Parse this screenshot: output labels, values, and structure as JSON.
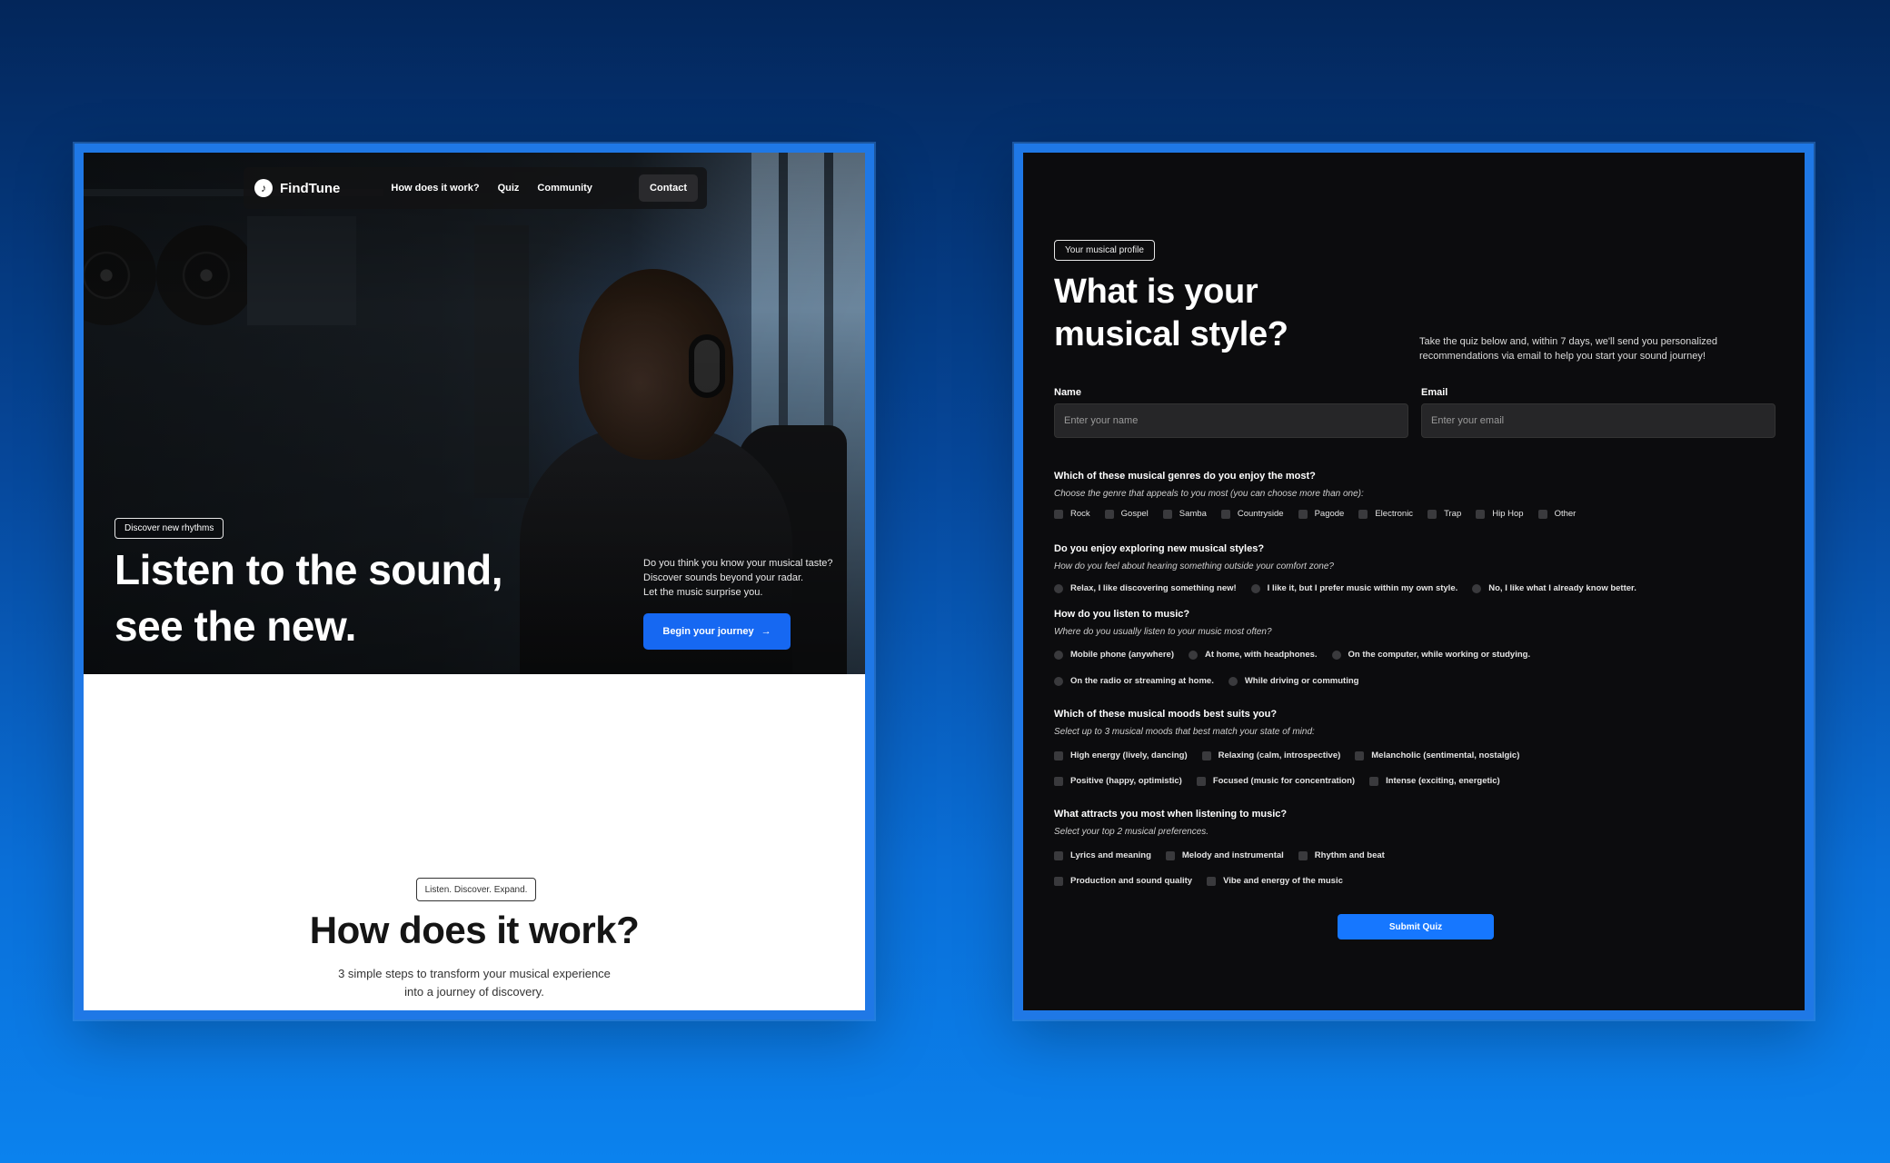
{
  "landing": {
    "nav": {
      "brand": "FindTune",
      "links": [
        "How does it work?",
        "Quiz",
        "Community"
      ],
      "contact": "Contact"
    },
    "hero": {
      "badge": "Discover new rhythms",
      "title_line1": "Listen to the sound,",
      "title_line2": "see the new.",
      "desc_line1": "Do you think you know your musical taste?",
      "desc_line2": "Discover sounds beyond your radar.",
      "desc_line3": "Let the music surprise you.",
      "cta": "Begin your journey",
      "cta_icon": "→"
    },
    "how": {
      "badge": "Listen. Discover. Expand.",
      "title": "How does it work?",
      "sub_line1": "3 simple steps to transform your musical experience",
      "sub_line2": "into a journey of discovery."
    }
  },
  "quiz": {
    "badge": "Your musical profile",
    "title": "What is your musical style?",
    "intro": "Take the quiz below and, within 7 days, we'll send you personalized recommendations via email to help you start your sound journey!",
    "name_label": "Name",
    "name_placeholder": "Enter your name",
    "email_label": "Email",
    "email_placeholder": "Enter your email",
    "q1": {
      "title": "Which of these musical genres do you enjoy the most?",
      "hint": "Choose the genre that appeals to you most (you can choose more than one):",
      "options": [
        "Rock",
        "Gospel",
        "Samba",
        "Countryside",
        "Pagode",
        "Electronic",
        "Trap",
        "Hip Hop",
        "Other"
      ]
    },
    "q2": {
      "title": "Do you enjoy exploring new musical styles?",
      "hint": "How do you feel about hearing something outside your comfort zone?",
      "options": [
        "Relax, I like discovering something new!",
        "I like it, but I prefer music within my own style.",
        "No, I like what I already know better."
      ]
    },
    "q3": {
      "title": "How do you listen to music?",
      "hint": "Where do you usually listen to your music most often?",
      "options": [
        "Mobile phone (anywhere)",
        "At home, with headphones.",
        "On the computer, while working or studying.",
        "On the radio or streaming at home.",
        "While driving or commuting"
      ]
    },
    "q4": {
      "title": "Which of these musical moods best suits you?",
      "hint": "Select up to 3 musical moods that best match your state of mind:",
      "options": [
        "High energy (lively, dancing)",
        "Relaxing (calm, introspective)",
        "Melancholic (sentimental, nostalgic)",
        "Positive (happy, optimistic)",
        "Focused (music for concentration)",
        "Intense (exciting, energetic)"
      ]
    },
    "q5": {
      "title": "What attracts you most when listening to music?",
      "hint": "Select your top 2 musical preferences.",
      "options": [
        "Lyrics and meaning",
        "Melody and instrumental",
        "Rhythm and beat",
        "Production and sound quality",
        "Vibe and energy of the music"
      ]
    },
    "submit": "Submit Quiz"
  },
  "colors": {
    "accent": "#1668f2",
    "frame": "#1f78e6",
    "dark_bg": "#0c0c0e"
  }
}
